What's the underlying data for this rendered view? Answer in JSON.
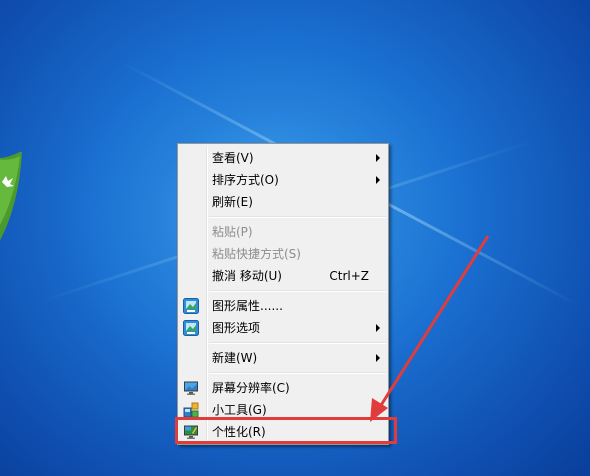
{
  "context_menu": {
    "items": [
      {
        "label": "查看(V)",
        "submenu": true
      },
      {
        "label": "排序方式(O)",
        "submenu": true
      },
      {
        "label": "刷新(E)"
      },
      {
        "label": "粘贴(P)",
        "disabled": true
      },
      {
        "label": "粘贴快捷方式(S)",
        "disabled": true
      },
      {
        "label": "撤消 移动(U)",
        "shortcut": "Ctrl+Z"
      },
      {
        "label": "图形属性......",
        "icon": "graphics-properties-icon"
      },
      {
        "label": "图形选项",
        "icon": "graphics-options-icon",
        "submenu": true
      },
      {
        "label": "新建(W)",
        "submenu": true
      },
      {
        "label": "屏幕分辨率(C)",
        "icon": "monitor-icon"
      },
      {
        "label": "小工具(G)",
        "icon": "gadgets-icon"
      },
      {
        "label": "个性化(R)",
        "icon": "personalize-icon",
        "highlighted": true
      }
    ]
  },
  "colors": {
    "desktop_blue": "#1a6fd0",
    "menu_background": "#f0f0f0",
    "annotation_red": "#e03c3c"
  }
}
